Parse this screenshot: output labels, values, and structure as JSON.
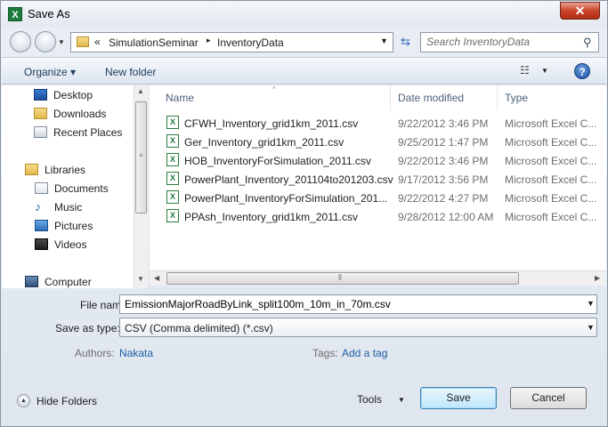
{
  "window": {
    "title": "Save As",
    "close_glyph": "✕"
  },
  "nav": {
    "address": {
      "chevrons": "«",
      "crumbs": [
        "SimulationSeminar",
        "InventoryData"
      ],
      "separator": "▸"
    },
    "search_placeholder": "Search InventoryData"
  },
  "toolbar": {
    "organize": "Organize ▾",
    "new_folder": "New folder",
    "help": "?"
  },
  "sidebar": {
    "favorites": [
      {
        "label": "Desktop",
        "icon": "desktop-icon"
      },
      {
        "label": "Downloads",
        "icon": "downloads-folder-icon"
      },
      {
        "label": "Recent Places",
        "icon": "recent-places-icon"
      }
    ],
    "libraries": {
      "label": "Libraries",
      "items": [
        {
          "label": "Documents",
          "icon": "documents-icon"
        },
        {
          "label": "Music",
          "icon": "music-icon"
        },
        {
          "label": "Pictures",
          "icon": "pictures-icon"
        },
        {
          "label": "Videos",
          "icon": "videos-icon"
        }
      ]
    },
    "computer": "Computer"
  },
  "file_list": {
    "columns": [
      "Name",
      "Date modified",
      "Type"
    ],
    "rows": [
      {
        "name": "CFWH_Inventory_grid1km_2011.csv",
        "date": "9/22/2012 3:46 PM",
        "type": "Microsoft Excel C..."
      },
      {
        "name": "Ger_Inventory_grid1km_2011.csv",
        "date": "9/25/2012 1:47 PM",
        "type": "Microsoft Excel C..."
      },
      {
        "name": "HOB_InventoryForSimulation_2011.csv",
        "date": "9/22/2012 3:46 PM",
        "type": "Microsoft Excel C..."
      },
      {
        "name": "PowerPlant_Inventory_201104to201203.csv",
        "date": "9/17/2012 3:56 PM",
        "type": "Microsoft Excel C..."
      },
      {
        "name": "PowerPlant_InventoryForSimulation_201...",
        "date": "9/22/2012 4:27 PM",
        "type": "Microsoft Excel C..."
      },
      {
        "name": "PPAsh_Inventory_grid1km_2011.csv",
        "date": "9/28/2012 12:00 AM",
        "type": "Microsoft Excel C..."
      }
    ]
  },
  "form": {
    "file_name_label": "File name:",
    "file_name_value": "EmissionMajorRoadByLink_split100m_10m_in_70m.csv",
    "save_type_label": "Save as type:",
    "save_type_value": "CSV (Comma delimited) (*.csv)",
    "authors_label": "Authors:",
    "authors_value": "Nakata",
    "tags_label": "Tags:",
    "tags_value": "Add a tag"
  },
  "footer": {
    "hide_folders": "Hide Folders",
    "tools": "Tools",
    "save": "Save",
    "cancel": "Cancel"
  },
  "colors": {
    "accent": "#1f5fa6",
    "close": "#c8432a",
    "excel_green": "#1e7b3e"
  }
}
